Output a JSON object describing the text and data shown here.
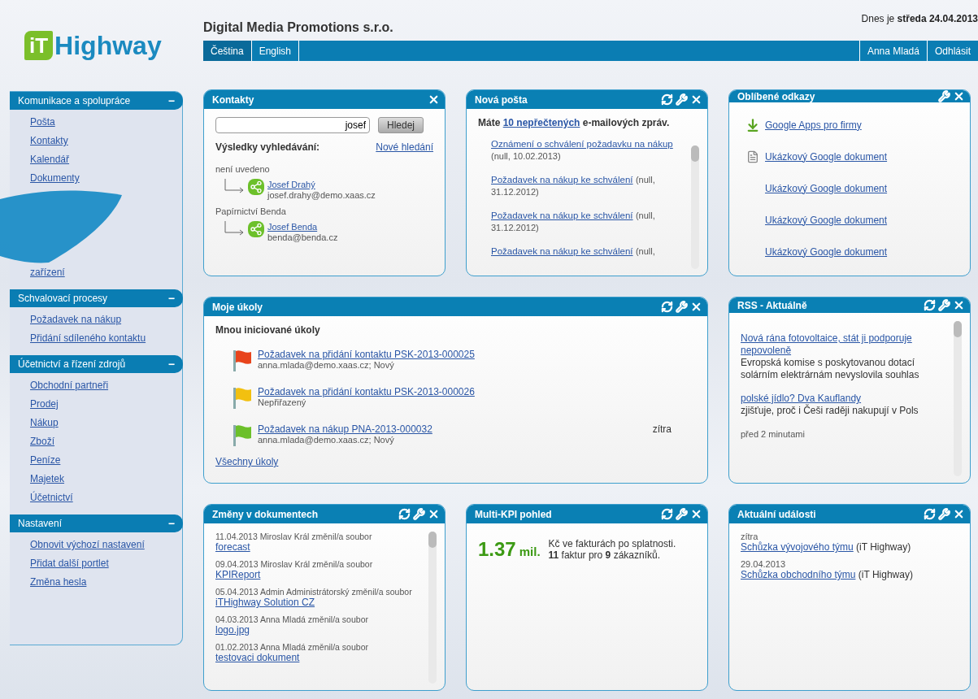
{
  "logo": {
    "mark": "iT",
    "name": "Highway"
  },
  "company": "Digital Media Promotions s.r.o.",
  "date": "Dnes je **středa 24.04.2013**",
  "languages": [
    {
      "label": "Čeština",
      "selected": true
    },
    {
      "label": "English",
      "selected": false
    }
  ],
  "user": "Anna Mladá",
  "logout": "Odhlásit",
  "sidebar": [
    {
      "title": "Komunikace a spolupráce",
      "toggle": "−",
      "items": [
        {
          "kind": "link",
          "label": "Pošta"
        },
        {
          "kind": "link",
          "label": "Kontakty"
        },
        {
          "kind": "link",
          "label": "Kalendář"
        },
        {
          "kind": "link",
          "label": "Dokumenty"
        },
        {
          "kind": "brush"
        },
        {
          "kind": "link",
          "label": "zařízení"
        }
      ]
    },
    {
      "title": "Schvalovací procesy",
      "toggle": "−",
      "items": [
        {
          "kind": "link",
          "label": "Požadavek na nákup"
        },
        {
          "kind": "link",
          "label": "Přidání sdíleného kontaktu"
        }
      ]
    },
    {
      "title": "Účetnictví a řízení zdrojů",
      "toggle": "−",
      "items": [
        {
          "kind": "link",
          "label": "Obchodní partneři"
        },
        {
          "kind": "link",
          "label": "Prodej"
        },
        {
          "kind": "link",
          "label": "Nákup"
        },
        {
          "kind": "link",
          "label": "Zboží"
        },
        {
          "kind": "link",
          "label": "Peníze"
        },
        {
          "kind": "link",
          "label": "Majetek"
        },
        {
          "kind": "link",
          "label": "Účetnictví"
        }
      ]
    },
    {
      "title": "Nastavení",
      "toggle": "−",
      "items": [
        {
          "kind": "link",
          "label": "Obnovit výchozí nastavení"
        },
        {
          "kind": "link",
          "label": "Přidat další portlet"
        },
        {
          "kind": "link",
          "label": "Změna hesla"
        }
      ]
    }
  ],
  "contacts": {
    "title": "Kontakty",
    "refresh": false,
    "settings": false,
    "close": true,
    "search_value": "josef",
    "search_button": "Hledej",
    "results_label": "Výsledky vyhledávání:",
    "new_search": "Nové hledání",
    "groups": [
      {
        "company": "není uvedeno",
        "name": "Josef Drahý",
        "email": "josef.drahy@demo.xaas.cz"
      },
      {
        "company": "Papírnictví Benda",
        "name": "Josef Benda",
        "email": "benda@benda.cz"
      }
    ]
  },
  "mail": {
    "title": "Nová pošta",
    "refresh": true,
    "settings": true,
    "close": true,
    "summary_prefix": "Máte",
    "summary_link": "10 nepřečtených",
    "summary_suffix": "e-mailových zpráv.",
    "items": [
      {
        "subject": "Oznámení o schválení požadavku na nákup",
        "meta": "(null, 10.02.2013)"
      },
      {
        "subject": "Požadavek na nákup ke schválení",
        "meta": "(null, 31.12.2012)"
      },
      {
        "subject": "Požadavek na nákup ke schválení",
        "meta": "(null, 31.12.2012)"
      },
      {
        "subject": "Požadavek na nákup ke schválení",
        "meta": "(null,"
      }
    ]
  },
  "links": {
    "title": "Oblíbené odkazy",
    "refresh": false,
    "settings": true,
    "close": true,
    "items": [
      {
        "kind": "download",
        "label": "Google Apps pro firmy"
      },
      {
        "kind": "document",
        "label": "Ukázkový Google dokument"
      },
      {
        "kind": "plain",
        "label": "Ukázkový Google dokument"
      },
      {
        "kind": "plain",
        "label": "Ukázkový Google dokument"
      },
      {
        "kind": "plain",
        "label": "Ukázkový Google dokument"
      }
    ]
  },
  "tasks": {
    "title": "Moje úkoly",
    "refresh": true,
    "settings": true,
    "close": true,
    "subtitle": "Mnou iniciované úkoly",
    "all_link": "Všechny úkoly",
    "items": [
      {
        "color": "#e8441c",
        "title": "Požadavek na přidání kontaktu PSK-2013-000025",
        "meta": "anna.mlada@demo.xaas.cz; Nový"
      },
      {
        "color": "#f2c010",
        "title": "Požadavek na přidání kontaktu PSK-2013-000026",
        "meta": "Nepřiřazený"
      },
      {
        "color": "#6cc02a",
        "title": "Požadavek na nákup PNA-2013-000032",
        "meta": "anna.mlada@demo.xaas.cz; Nový",
        "due": "zítra"
      }
    ]
  },
  "rss": {
    "title": "RSS - Aktuálně",
    "refresh": true,
    "settings": true,
    "close": true,
    "items": [
      {
        "title": "Nová rána fotovoltaice, stát ji podporuje nepovoleně",
        "desc": "Evropská komise s poskytovanou dotací solárním elektrárnám nevyslovila souhlas"
      },
      {
        "title": "polské jídlo? Dva Kauflandy",
        "desc": "zjišťuje, proč i Češi raději nakupují v Pols"
      },
      {
        "time": "před 2 minutami"
      }
    ]
  },
  "documents": {
    "title": "Změny v dokumentech",
    "refresh": true,
    "settings": true,
    "close": true,
    "items": [
      {
        "meta": "11.04.2013 Miroslav Král změnil/a soubor",
        "file": "forecast"
      },
      {
        "meta": "09.04.2013 Miroslav Král změnil/a soubor",
        "file": "KPIReport"
      },
      {
        "meta": "05.04.2013 Admin Administrátorský změnil/a soubor",
        "file": "iTHighway Solution CZ"
      },
      {
        "meta": "04.03.2013 Anna Mladá změnil/a soubor",
        "file": "logo.jpg"
      },
      {
        "meta": "01.02.2013 Anna Mladá změnil/a soubor",
        "file": "testovaci dokument"
      }
    ]
  },
  "kpi": {
    "title": "Multi-KPI pohled",
    "refresh": true,
    "settings": true,
    "close": true,
    "value": "1.37",
    "unit": "mil.",
    "line_1": "Kč ve fakturách po splatnosti.",
    "line_2": "**11** faktur pro **9** zákazníků."
  },
  "events": {
    "title": "Aktuální události",
    "refresh": true,
    "settings": true,
    "close": true,
    "items": [
      {
        "when": "zítra",
        "link": "Schůzka vývojového týmu",
        "suffix": "(iT Highway)"
      },
      {
        "when": "29.04.2013",
        "link": "Schůzka obchodního týmu",
        "suffix": "(iT Highway)"
      }
    ]
  }
}
